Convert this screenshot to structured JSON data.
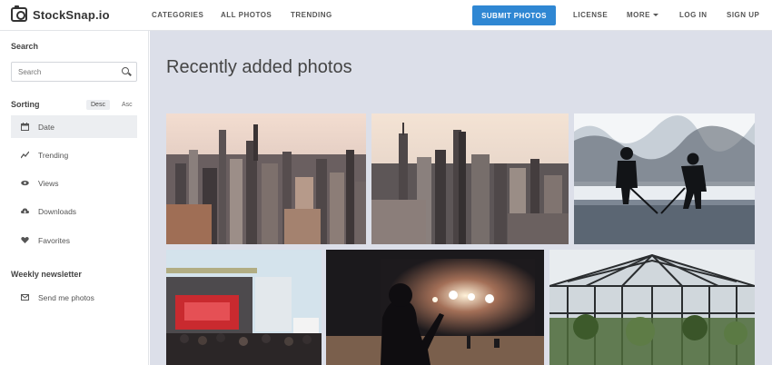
{
  "header": {
    "logo_text": "StockSnap.io",
    "nav": {
      "categories": "CATEGORIES",
      "all_photos": "ALL PHOTOS",
      "trending": "TRENDING"
    },
    "submit_label": "SUBMIT PHOTOS",
    "right_nav": {
      "license": "LICENSE",
      "more": "MORE",
      "login": "LOG IN",
      "signup": "SIGN UP"
    },
    "accent_color": "#2f87d3"
  },
  "sidebar": {
    "search_heading": "Search",
    "search_placeholder": "Search",
    "sorting_heading": "Sorting",
    "sort_desc": "Desc",
    "sort_asc": "Asc",
    "sort_items": [
      {
        "label": "Date",
        "icon": "calendar-icon",
        "active": true
      },
      {
        "label": "Trending",
        "icon": "trending-icon",
        "active": false
      },
      {
        "label": "Views",
        "icon": "eye-icon",
        "active": false
      },
      {
        "label": "Downloads",
        "icon": "cloud-download-icon",
        "active": false
      },
      {
        "label": "Favorites",
        "icon": "heart-icon",
        "active": false
      }
    ],
    "newsletter_heading": "Weekly newsletter",
    "newsletter_item": {
      "label": "Send me photos",
      "icon": "envelope-icon"
    }
  },
  "main": {
    "title": "Recently added photos",
    "background": "#dcdfe9",
    "photos": [
      {
        "subject": "city-skyline-aerial-1"
      },
      {
        "subject": "city-skyline-aerial-2"
      },
      {
        "subject": "ice-hockey-silhouettes"
      },
      {
        "subject": "outdoor-concert-stage"
      },
      {
        "subject": "concert-crowd-silhouette"
      },
      {
        "subject": "glass-conservatory-dome"
      }
    ]
  }
}
